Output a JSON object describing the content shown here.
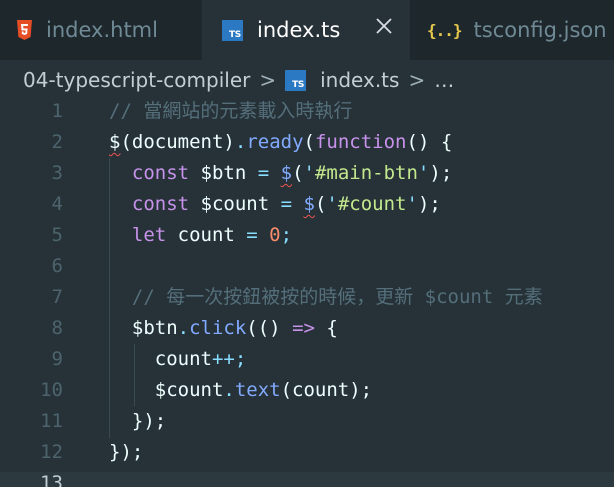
{
  "tabs": [
    {
      "label": "index.html",
      "icon": "html5-icon",
      "active": false
    },
    {
      "label": "index.ts",
      "icon": "typescript-icon",
      "active": true,
      "close": "×"
    },
    {
      "label": "tsconfig.json",
      "icon": "json-braces-icon",
      "active": false
    }
  ],
  "icons": {
    "ts_text": "TS",
    "json_text": "{..}"
  },
  "breadcrumb": {
    "folder": "04-typescript-compiler",
    "separator": ">",
    "file": "index.ts",
    "ellipsis": "…"
  },
  "editor": {
    "current_line": 13,
    "line_numbers": [
      "1",
      "2",
      "3",
      "4",
      "5",
      "6",
      "7",
      "8",
      "9",
      "10",
      "11",
      "12",
      "13"
    ],
    "lines": [
      [
        {
          "t": "// 當網站的元素載入時執行",
          "c": "comment"
        }
      ],
      [
        {
          "t": "$",
          "c": "plain",
          "squiggle": true
        },
        {
          "t": "(",
          "c": "plain"
        },
        {
          "t": "document",
          "c": "plain"
        },
        {
          "t": ")",
          "c": "plain"
        },
        {
          "t": ".",
          "c": "punct"
        },
        {
          "t": "ready",
          "c": "func"
        },
        {
          "t": "(",
          "c": "plain"
        },
        {
          "t": "function",
          "c": "storage"
        },
        {
          "t": "() {",
          "c": "plain"
        }
      ],
      [
        {
          "t": "  const ",
          "c": "storage"
        },
        {
          "t": "$btn",
          "c": "var"
        },
        {
          "t": " = ",
          "c": "op"
        },
        {
          "t": "$",
          "c": "func",
          "squiggle": true
        },
        {
          "t": "(",
          "c": "plain"
        },
        {
          "t": "'",
          "c": "punct"
        },
        {
          "t": "#main-btn",
          "c": "string"
        },
        {
          "t": "'",
          "c": "punct"
        },
        {
          "t": ");",
          "c": "plain"
        }
      ],
      [
        {
          "t": "  const ",
          "c": "storage"
        },
        {
          "t": "$count",
          "c": "var"
        },
        {
          "t": " = ",
          "c": "op"
        },
        {
          "t": "$",
          "c": "func",
          "squiggle": true
        },
        {
          "t": "(",
          "c": "plain"
        },
        {
          "t": "'",
          "c": "punct"
        },
        {
          "t": "#count",
          "c": "string"
        },
        {
          "t": "'",
          "c": "punct"
        },
        {
          "t": ");",
          "c": "plain"
        }
      ],
      [
        {
          "t": "  let ",
          "c": "storage"
        },
        {
          "t": "count",
          "c": "var"
        },
        {
          "t": " = ",
          "c": "op"
        },
        {
          "t": "0",
          "c": "number"
        },
        {
          "t": ";",
          "c": "punct"
        }
      ],
      [],
      [
        {
          "t": "  // 每一次按鈕被按的時候，更新 $count 元素",
          "c": "comment"
        }
      ],
      [
        {
          "t": "  $btn",
          "c": "var"
        },
        {
          "t": ".",
          "c": "punct"
        },
        {
          "t": "click",
          "c": "func"
        },
        {
          "t": "(() ",
          "c": "plain"
        },
        {
          "t": "=>",
          "c": "storage"
        },
        {
          "t": " {",
          "c": "plain"
        }
      ],
      [
        {
          "t": "    count",
          "c": "var"
        },
        {
          "t": "++",
          "c": "op"
        },
        {
          "t": ";",
          "c": "punct"
        }
      ],
      [
        {
          "t": "    $count",
          "c": "var"
        },
        {
          "t": ".",
          "c": "punct"
        },
        {
          "t": "text",
          "c": "func"
        },
        {
          "t": "(count);",
          "c": "plain"
        }
      ],
      [
        {
          "t": "  });",
          "c": "plain"
        }
      ],
      [
        {
          "t": "});",
          "c": "plain"
        }
      ],
      []
    ]
  },
  "colors": {
    "background": "#263238",
    "tabbar": "#1e272c",
    "typescript_blue": "#2b79c2",
    "html5_orange": "#e44d26",
    "json_yellow": "#e6c84c",
    "error_squiggle": "#ef5350"
  }
}
